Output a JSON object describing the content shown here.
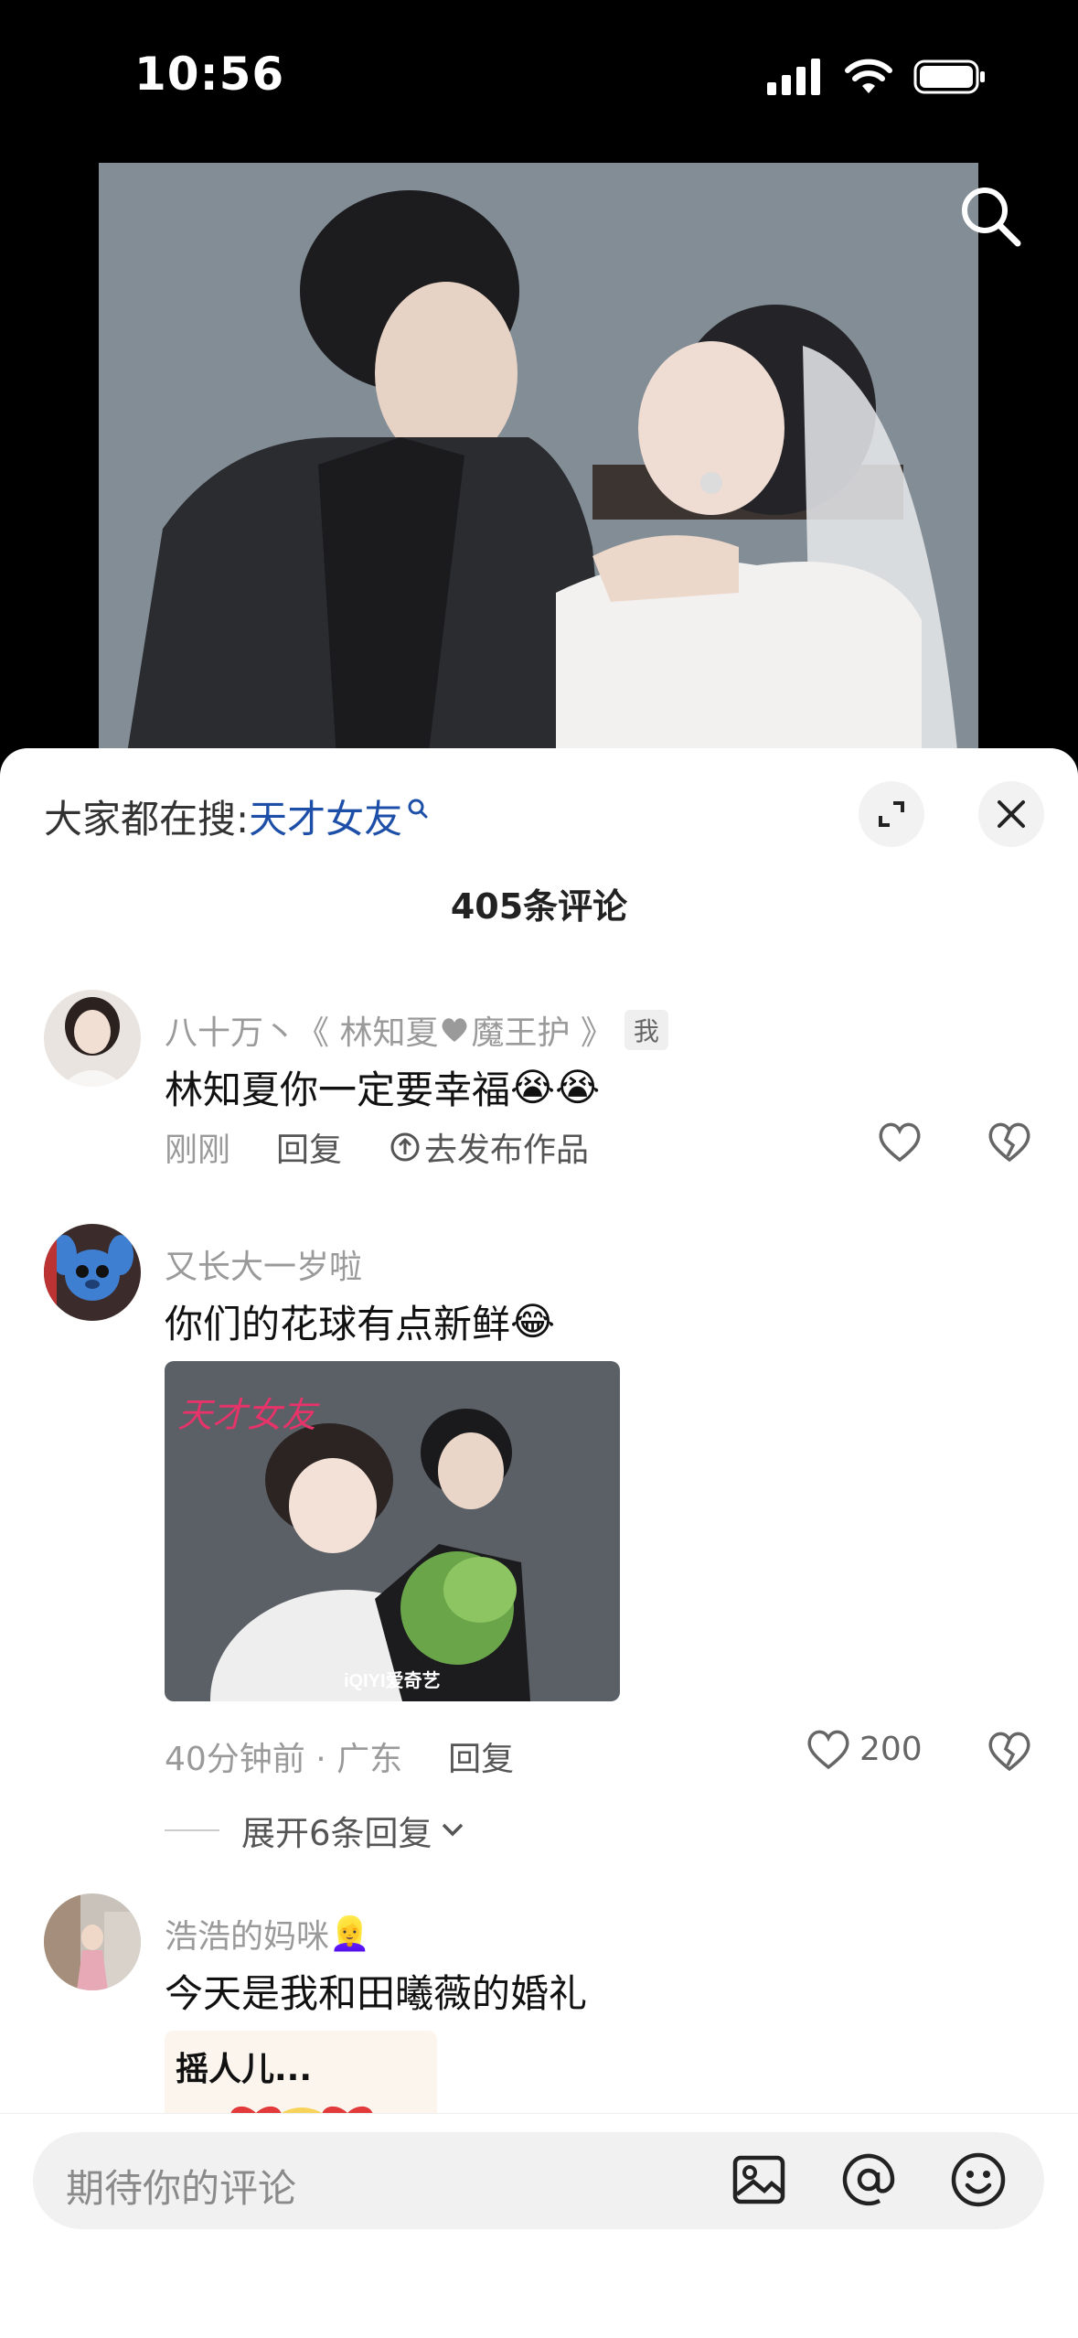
{
  "status_bar": {
    "time": "10:56"
  },
  "video": {
    "search_icon": "search-icon"
  },
  "panel": {
    "hot_search_prefix": "大家都在搜:",
    "hot_search_keyword": "天才女友",
    "comment_count": "405条评论"
  },
  "comments": [
    {
      "author": "八十万丶《 林知夏",
      "author_suffix": "魔王护 》",
      "badge": "我",
      "text": "林知夏你一定要幸福",
      "emoji": "😭😭",
      "time": "刚刚",
      "reply": "回复",
      "publish": "去发布作品"
    },
    {
      "author": "又长大一岁啦",
      "text": "你们的花球有点新鲜",
      "emoji": "😂",
      "image_title": "天才女友",
      "image_watermark": "iQIYI爱奇艺",
      "time": "40分钟前 · 广东",
      "reply": "回复",
      "likes": "200",
      "expand": "展开6条回复"
    },
    {
      "author": "浩浩的妈咪",
      "author_emoji": "👱‍♀️",
      "text": "今天是我和田曦薇的婚礼",
      "image_text": "摇人儿..."
    }
  ],
  "input": {
    "placeholder": "期待你的评论"
  },
  "colors": {
    "accent": "#1e4fa8",
    "muted": "#9a9a9a"
  }
}
